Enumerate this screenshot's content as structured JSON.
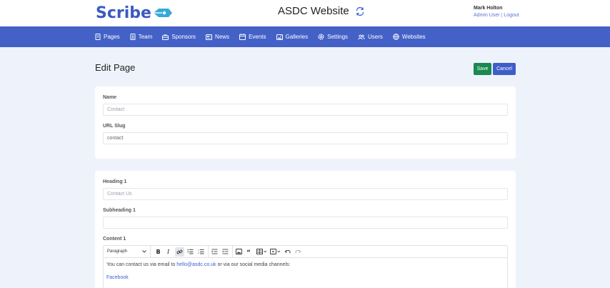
{
  "brand": {
    "logo_text": "Scribe",
    "accent": "#4361c7"
  },
  "header": {
    "site_title": "ASDC Website"
  },
  "user": {
    "name": "Mark Holton",
    "role": "Admin User",
    "separator": " | ",
    "logout": "Logout"
  },
  "nav": {
    "items": [
      {
        "label": "Pages",
        "icon": "page-icon"
      },
      {
        "label": "Team",
        "icon": "team-icon"
      },
      {
        "label": "Sponsors",
        "icon": "sponsors-icon"
      },
      {
        "label": "News",
        "icon": "news-icon"
      },
      {
        "label": "Events",
        "icon": "calendar-icon"
      },
      {
        "label": "Galleries",
        "icon": "image-icon"
      },
      {
        "label": "Settings",
        "icon": "gear-icon"
      },
      {
        "label": "Users",
        "icon": "users-icon"
      },
      {
        "label": "Websites",
        "icon": "globe-icon"
      }
    ]
  },
  "page": {
    "title": "Edit Page",
    "save_label": "Save",
    "cancel_label": "Cancel"
  },
  "form": {
    "name_label": "Name",
    "name_placeholder": "Contact",
    "slug_label": "URL Slug",
    "slug_value": "contact",
    "heading1_label": "Heading 1",
    "heading1_placeholder": "Contact Us",
    "subheading1_label": "Subheading 1",
    "subheading1_value": "",
    "content1_label": "Content 1"
  },
  "editor": {
    "block_format": "Paragraph",
    "text_before": "You can contact us via email to ",
    "email_link": "hello@asdc.co.uk",
    "text_after": " or via our social media channels:",
    "facebook_link": "Facebook"
  }
}
